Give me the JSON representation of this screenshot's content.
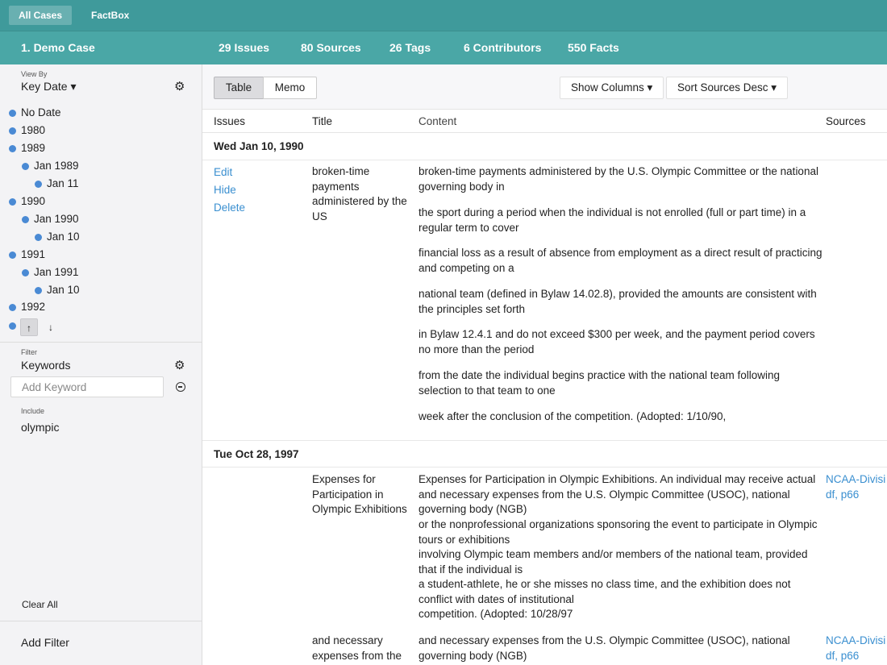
{
  "topbar": {
    "tabs": [
      "All Cases",
      "FactBox"
    ]
  },
  "casebar": {
    "items": [
      "1. Demo Case",
      "29 Issues",
      "80 Sources",
      "26 Tags",
      "6 Contributors",
      "550 Facts"
    ]
  },
  "sidebar": {
    "view_by_label": "View By",
    "view_by_value": "Key Date ▾",
    "tree": [
      {
        "label": "No Date",
        "level": 0
      },
      {
        "label": "1980",
        "level": 0
      },
      {
        "label": "1989",
        "level": 0
      },
      {
        "label": "Jan 1989",
        "level": 1
      },
      {
        "label": "Jan 11",
        "level": 2
      },
      {
        "label": "1990",
        "level": 0
      },
      {
        "label": "Jan 1990",
        "level": 1
      },
      {
        "label": "Jan 10",
        "level": 2
      },
      {
        "label": "1991",
        "level": 0
      },
      {
        "label": "Jan 1991",
        "level": 1
      },
      {
        "label": "Jan 10",
        "level": 2
      },
      {
        "label": "1992",
        "level": 0
      }
    ],
    "up_arrow": "↑",
    "down_arrow": "↓",
    "filter_label": "Filter",
    "filter_title": "Keywords",
    "keyword_placeholder": "Add Keyword",
    "include_label": "Include",
    "include_value": "olympic",
    "clear_all": "Clear All",
    "add_filter": "Add Filter"
  },
  "toolbar": {
    "view_tabs": [
      "Table",
      "Memo"
    ],
    "show_columns": "Show Columns ▾",
    "sort_sources": "Sort Sources Desc ▾"
  },
  "table": {
    "columns": [
      "Issues",
      "Title",
      "Content",
      "Sources"
    ],
    "group1": {
      "date": "Wed Jan 10, 1990",
      "actions": [
        "Edit",
        "Hide",
        "Delete"
      ],
      "title": "broken-time payments administered by the US",
      "content": [
        "broken-time payments administered by the U.S. Olympic Committee or the national governing body in",
        "the sport during a period when the individual is not enrolled (full or part time) in a regular term to cover",
        "financial loss as a result of absence from employment as a direct result of practicing and competing on a",
        "national team (defined in Bylaw 14.02.8), provided the amounts are consistent with the principles set forth",
        "in Bylaw 12.4.1 and do not exceed $300 per week, and the payment period covers no more than the period",
        "from the date the individual begins practice with the national team following selection to that team to one",
        "week after the conclusion of the competition. (Adopted: 1/10/90,"
      ]
    },
    "group2": {
      "date": "Tue Oct 28, 1997",
      "row1": {
        "title": "Expenses for Participation in Olympic Exhibitions",
        "content_lines": [
          "Expenses for Participation in Olympic Exhibitions. An individual may receive actual and necessary expenses from the U.S. Olympic Committee (USOC), national governing body (NGB)",
          "or the nonprofessional organizations sponsoring the event to participate in Olympic tours or exhibitions",
          "involving Olympic team members and/or members of the national team, provided that if the individual is",
          "a student-athlete, he or she misses no class time, and the exhibition does not conflict with dates of institutional",
          "competition. (Adopted: 10/28/97"
        ],
        "source": "NCAA-Divisi df, p66"
      },
      "row2": {
        "title": "and necessary expenses from the",
        "content": "and necessary expenses from the U.S. Olympic Committee (USOC), national governing body (NGB)",
        "source": "NCAA-Divisi df, p66"
      }
    }
  }
}
